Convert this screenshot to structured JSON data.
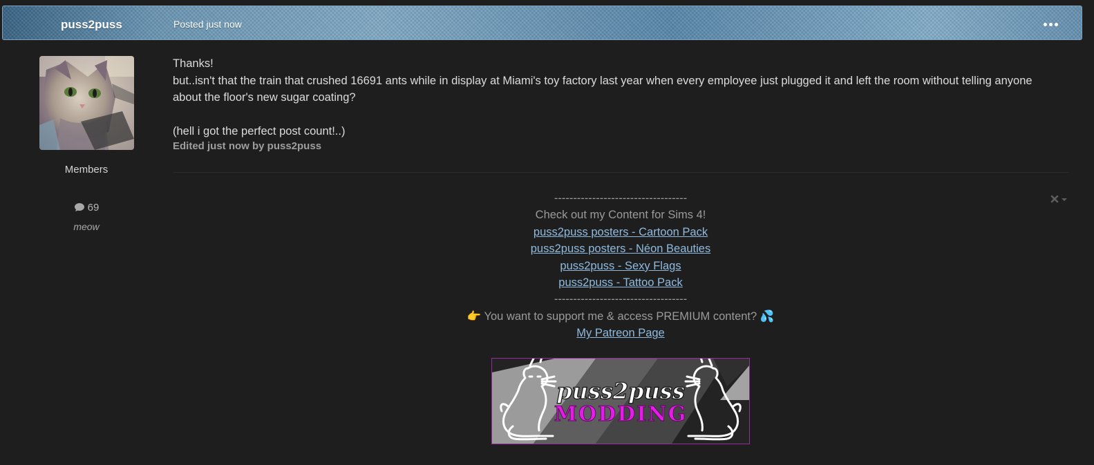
{
  "header": {
    "author": "puss2puss",
    "posted": "Posted just now"
  },
  "author_panel": {
    "group": "Members",
    "post_count": "69",
    "title": "meow"
  },
  "post": {
    "lines": [
      "Thanks!",
      "but..isn't that the train that crushed 16691 ants while in display at Miami's toy factory last year when every employee just plugged it and left the room without telling anyone about the floor's new sugar coating?",
      "(hell i got the perfect post count!..)"
    ],
    "edited": "Edited just now by puss2puss"
  },
  "signature": {
    "separator_top": "-----------------------------------",
    "heading": "Check out my Content for Sims 4!",
    "links": [
      "puss2puss posters - Cartoon Pack",
      "puss2puss posters - Néon Beauties",
      "puss2puss - Sexy Flags",
      "puss2puss - Tattoo Pack"
    ],
    "separator_bottom": "-----------------------------------",
    "support_text": "You want to support me & access PREMIUM content?",
    "patreon_link": "My Patreon Page",
    "banner_text_top": "puss2puss",
    "banner_text_bottom": "MODDING"
  },
  "icons": {
    "more": "more-dots-icon",
    "comment": "comment-icon",
    "pointing_hand": "pointing-hand-emoji",
    "sweat_droplets": "sweat-droplets-emoji",
    "close": "close-icon",
    "caret": "caret-down-icon"
  },
  "colors": {
    "background": "#1e1e1e",
    "header_blue": "#6d98b6",
    "link": "#8fbbe0",
    "banner_magenta": "#e21ee6"
  }
}
